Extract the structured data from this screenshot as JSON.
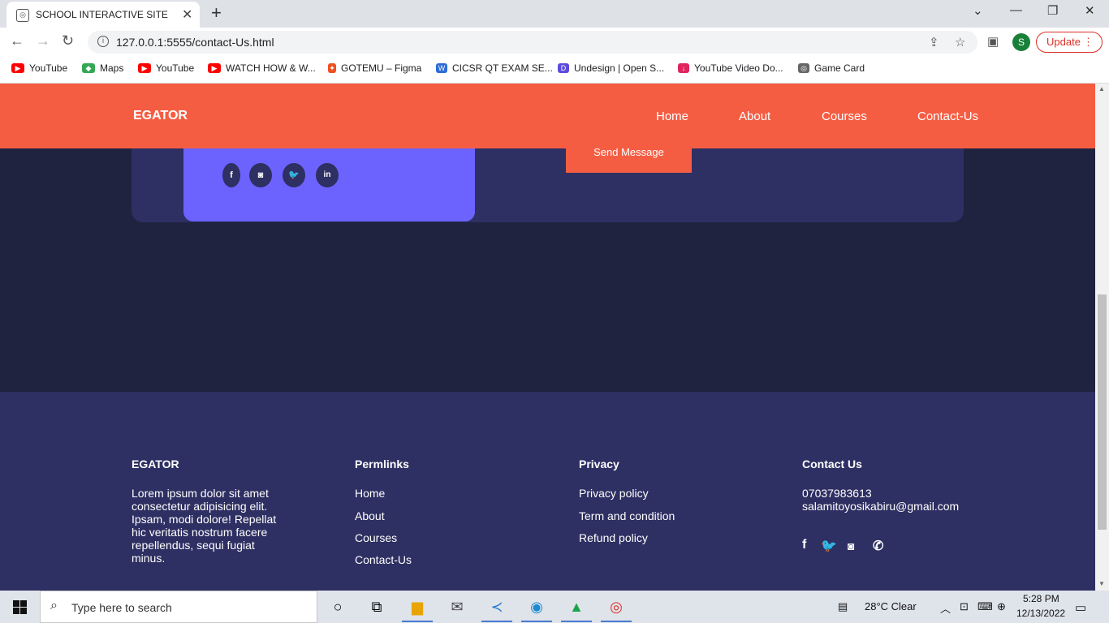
{
  "browser": {
    "tab_title": "SCHOOL INTERACTIVE SITE",
    "url": "127.0.0.1:5555/contact-Us.html",
    "avatar_letter": "S",
    "update_label": "Update",
    "bookmarks": [
      {
        "label": "YouTube",
        "icon": "youtube-icon",
        "color": "#ff0000"
      },
      {
        "label": "Maps",
        "icon": "maps-icon",
        "color": "#34a853"
      },
      {
        "label": "YouTube",
        "icon": "youtube-icon",
        "color": "#ff0000"
      },
      {
        "label": "WATCH HOW & W...",
        "icon": "youtube-icon",
        "color": "#ff0000"
      },
      {
        "label": "GOTEMU – Figma",
        "icon": "figma-icon",
        "color": "#f24e1e"
      },
      {
        "label": "CICSR QT EXAM SE...",
        "icon": "document-icon",
        "color": "#2b6cd6"
      },
      {
        "label": "Undesign | Open S...",
        "icon": "undesign-icon",
        "color": "#5b4bdb"
      },
      {
        "label": "YouTube Video Do...",
        "icon": "download-icon",
        "color": "#e0245e"
      },
      {
        "label": "Game Card",
        "icon": "gamecard-icon",
        "color": "#666666"
      }
    ]
  },
  "nav": {
    "logo": "EGATOR",
    "links": [
      "Home",
      "About",
      "Courses",
      "Contact-Us"
    ]
  },
  "contact": {
    "send_label": "Send Message",
    "socials": [
      "f",
      "◙",
      "🐦",
      "in"
    ]
  },
  "footer": {
    "brand": {
      "title": "EGATOR",
      "text": "Lorem ipsum dolor sit amet consectetur adipisicing elit. Ipsam, modi dolore! Repellat hic veritatis nostrum facere repellendus, sequi fugiat minus."
    },
    "permlinks": {
      "title": "Permlinks",
      "links": [
        "Home",
        "About",
        "Courses",
        "Contact-Us"
      ]
    },
    "privacy": {
      "title": "Privacy",
      "links": [
        "Privacy policy",
        "Term and condition",
        "Refund policy"
      ]
    },
    "contact": {
      "title": "Contact Us",
      "phone": "07037983613",
      "email": "salamitoyosikabiru@gmail.com"
    }
  },
  "taskbar": {
    "search_placeholder": "Type here to search",
    "weather": "28°C  Clear",
    "time": "5:28 PM",
    "date": "12/13/2022"
  },
  "colors": {
    "accent": "#f55d43",
    "dark": "#1f2340",
    "panel": "#2e2f62",
    "purple": "#6c63ff"
  }
}
